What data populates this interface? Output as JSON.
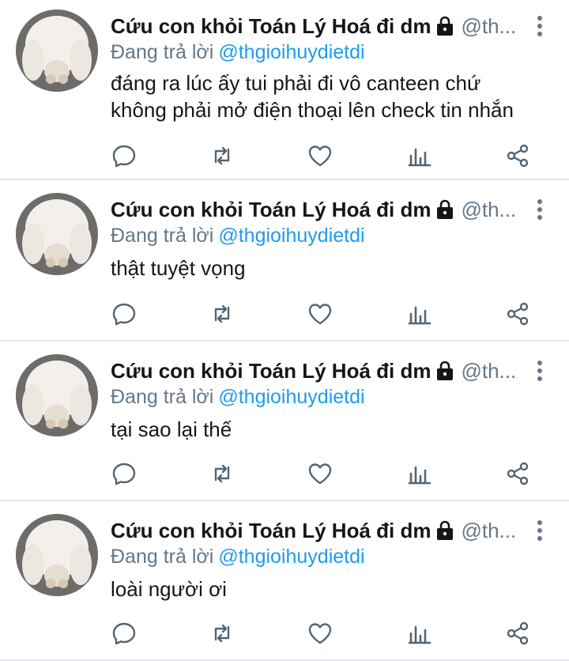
{
  "tweets": [
    {
      "display_name": "Cứu con khỏi Toán Lý Hoá đi dm",
      "handle": "@th...",
      "reply_prefix": "Đang trả lời",
      "reply_to": "@thgioihuydietdi",
      "text_lines": [
        "đáng ra lúc ấy tui phải đi vô canteen chứ",
        "không phải mở điện thoại lên check tin nhắn"
      ]
    },
    {
      "display_name": "Cứu con khỏi Toán Lý Hoá đi dm",
      "handle": "@th...",
      "reply_prefix": "Đang trả lời",
      "reply_to": "@thgioihuydietdi",
      "text_lines": [
        "thật tuyệt vọng"
      ]
    },
    {
      "display_name": "Cứu con khỏi Toán Lý Hoá đi dm",
      "handle": "@th...",
      "reply_prefix": "Đang trả lời",
      "reply_to": "@thgioihuydietdi",
      "text_lines": [
        "tại sao lại thế"
      ]
    },
    {
      "display_name": "Cứu con khỏi Toán Lý Hoá đi dm",
      "handle": "@th...",
      "reply_prefix": "Đang trả lời",
      "reply_to": "@thgioihuydietdi",
      "text_lines": [
        "loài người ơi"
      ]
    }
  ],
  "icons": {
    "lock": "lock-icon",
    "more": "more-vertical-icon",
    "reply": "reply-icon",
    "retweet": "retweet-icon",
    "like": "heart-icon",
    "stats": "stats-icon",
    "share": "share-icon"
  },
  "colors": {
    "text": "#14171a",
    "secondary": "#657786",
    "mention": "#1d9bf0",
    "divider": "#e1e6ea"
  }
}
